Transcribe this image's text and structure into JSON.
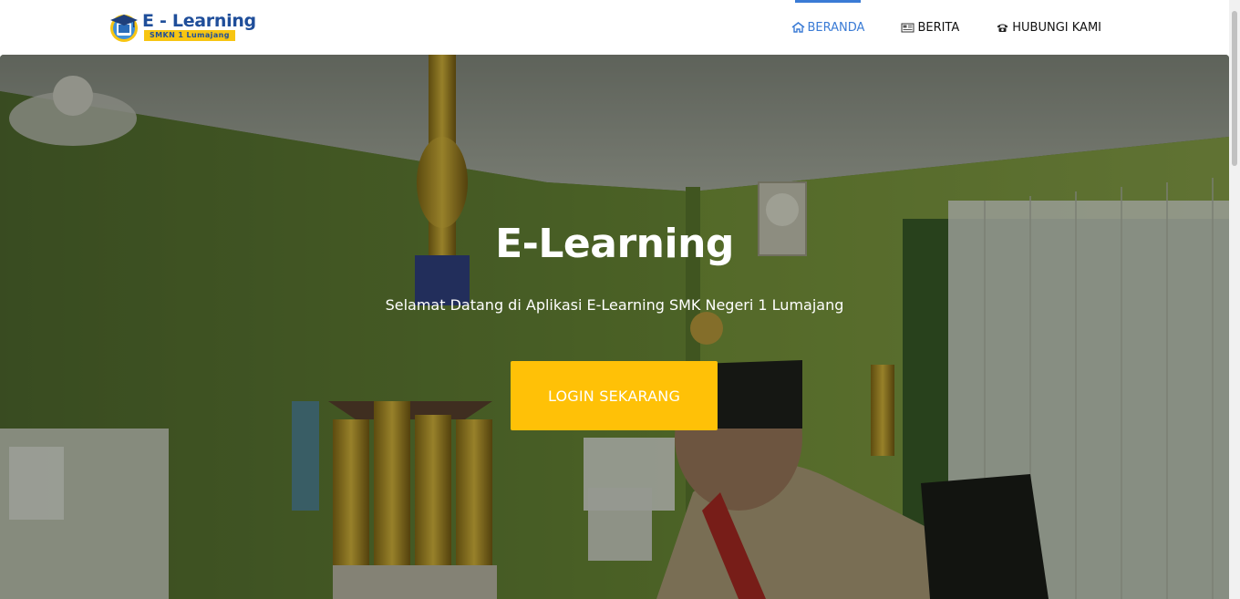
{
  "header": {
    "logo": {
      "title": "E - Learning",
      "subtitle": "SMKN 1 Lumajang"
    },
    "nav": [
      {
        "label": "BERANDA",
        "icon": "home-icon",
        "active": true
      },
      {
        "label": "BERITA",
        "icon": "newspaper-icon",
        "active": false
      },
      {
        "label": "HUBUNGI KAMI",
        "icon": "phone-icon",
        "active": false
      }
    ]
  },
  "hero": {
    "title": "E-Learning",
    "subtitle": "Selamat Datang di Aplikasi E-Learning SMK Negeri 1 Lumajang",
    "button_label": "LOGIN SEKARANG"
  },
  "colors": {
    "accent": "#3a7bd5",
    "button": "#ffc107",
    "logo_blue": "#1f4e9a",
    "logo_yellow": "#f7c512"
  }
}
